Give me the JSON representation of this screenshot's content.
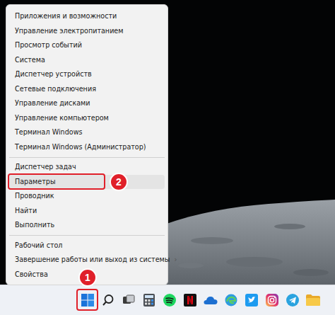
{
  "menu": {
    "items": [
      {
        "kind": "item",
        "label": "Приложения и возможности",
        "selected": false
      },
      {
        "kind": "item",
        "label": "Управление электропитанием",
        "selected": false
      },
      {
        "kind": "item",
        "label": "Просмотр событий",
        "selected": false
      },
      {
        "kind": "item",
        "label": "Система",
        "selected": false
      },
      {
        "kind": "item",
        "label": "Диспетчер устройств",
        "selected": false
      },
      {
        "kind": "item",
        "label": "Сетевые подключения",
        "selected": false
      },
      {
        "kind": "item",
        "label": "Управление дисками",
        "selected": false
      },
      {
        "kind": "item",
        "label": "Управление компьютером",
        "selected": false
      },
      {
        "kind": "item",
        "label": "Терминал Windows",
        "selected": false
      },
      {
        "kind": "item",
        "label": "Терминал Windows (Администратор)",
        "selected": false
      },
      {
        "kind": "separator"
      },
      {
        "kind": "item",
        "label": "Диспетчер задач",
        "selected": false
      },
      {
        "kind": "item",
        "label": "Параметры",
        "selected": true
      },
      {
        "kind": "item",
        "label": "Проводник",
        "selected": false
      },
      {
        "kind": "item",
        "label": "Найти",
        "selected": false
      },
      {
        "kind": "item",
        "label": "Выполнить",
        "selected": false
      },
      {
        "kind": "separator"
      },
      {
        "kind": "item",
        "label": "Рабочий стол",
        "selected": false
      },
      {
        "kind": "item",
        "label": "Завершение работы или выход из системы",
        "selected": false,
        "arrow": "›"
      },
      {
        "kind": "item",
        "label": "Свойства",
        "selected": false
      }
    ]
  },
  "annotations": [
    {
      "label": "1"
    },
    {
      "label": "2"
    }
  ]
}
